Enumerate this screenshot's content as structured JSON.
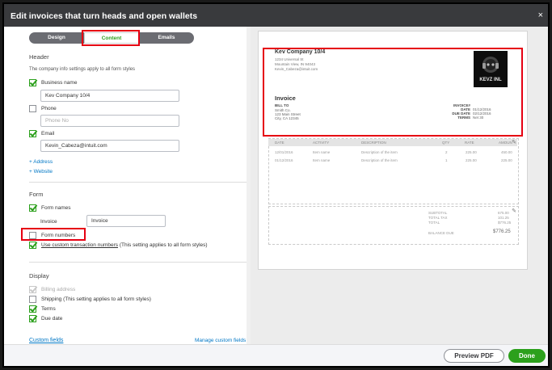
{
  "window": {
    "title": "Edit invoices that turn heads and open wallets",
    "close_glyph": "×"
  },
  "tabs": [
    {
      "label": "Design"
    },
    {
      "label": "Content"
    },
    {
      "label": "Emails"
    }
  ],
  "header": {
    "title": "Header",
    "note": "The company info settings apply to all form styles",
    "business_name": {
      "label": "Business name",
      "value": "Kev Company 10/4"
    },
    "phone": {
      "label": "Phone",
      "placeholder": "Phone No"
    },
    "email": {
      "label": "Email",
      "value": "Kevin_Cabeza@intuit.com"
    },
    "add_address": "+ Address",
    "add_website": "+ Website"
  },
  "form": {
    "title": "Form",
    "form_names": {
      "label": "Form names"
    },
    "invoice_label": "Invoice",
    "invoice_value": "Invoice",
    "form_numbers": {
      "label": "Form numbers"
    },
    "custom_txn": {
      "label": "Use custom transaction numbers",
      "note": "(This setting applies to all form styles)"
    }
  },
  "display": {
    "title": "Display",
    "billing_address": "Billing address",
    "shipping": "Shipping",
    "shipping_note": "(This setting applies to all form styles)",
    "terms": "Terms",
    "due_date": "Due date"
  },
  "custom_fields": {
    "label": "Custom fields",
    "manage": "Manage custom fields"
  },
  "preview": {
    "company_name": "Kev Company 10/4",
    "address_1": "1234 Universal St",
    "address_2": "Mountain View, IN 94043",
    "email": "Kevin_Cabeza@intuit.com",
    "logo_text": "KEVZ INL",
    "doc_title": "Invoice",
    "bill_to_label": "BILL TO",
    "bill_to_1": "Smith Co.",
    "bill_to_2": "123 Main Street",
    "bill_to_3": "City, CA 12345",
    "meta_labels": [
      "INVOICE#",
      "DATE",
      "DUE DATE",
      "TERMS"
    ],
    "meta_values": [
      "",
      "01/12/2016",
      "02/12/2016",
      "Net 30"
    ],
    "columns": [
      "DATE",
      "ACTIVITY",
      "DESCRIPTION",
      "QTY",
      "RATE",
      "AMOUN"
    ],
    "rows": [
      [
        "12/01/2016",
        "Item name",
        "Description of the item",
        "2",
        "225.00",
        "450.00"
      ],
      [
        "01/12/2016",
        "Item name",
        "Description of the item",
        "1",
        "225.00",
        "225.00"
      ]
    ],
    "totals_labels": [
      "SUBTOTAL",
      "TOTAL TAX",
      "TOTAL"
    ],
    "totals_values": [
      "675.00",
      "101.25",
      "$776.25"
    ],
    "balance_label": "BALANCE DUE",
    "balance_value": "$776.25"
  },
  "footer": {
    "preview_pdf": "Preview PDF",
    "done": "Done"
  },
  "colors": {
    "accent": "#2ca01c",
    "titlebar": "#393a3d",
    "highlight": "#e60012",
    "link": "#0077c5"
  }
}
